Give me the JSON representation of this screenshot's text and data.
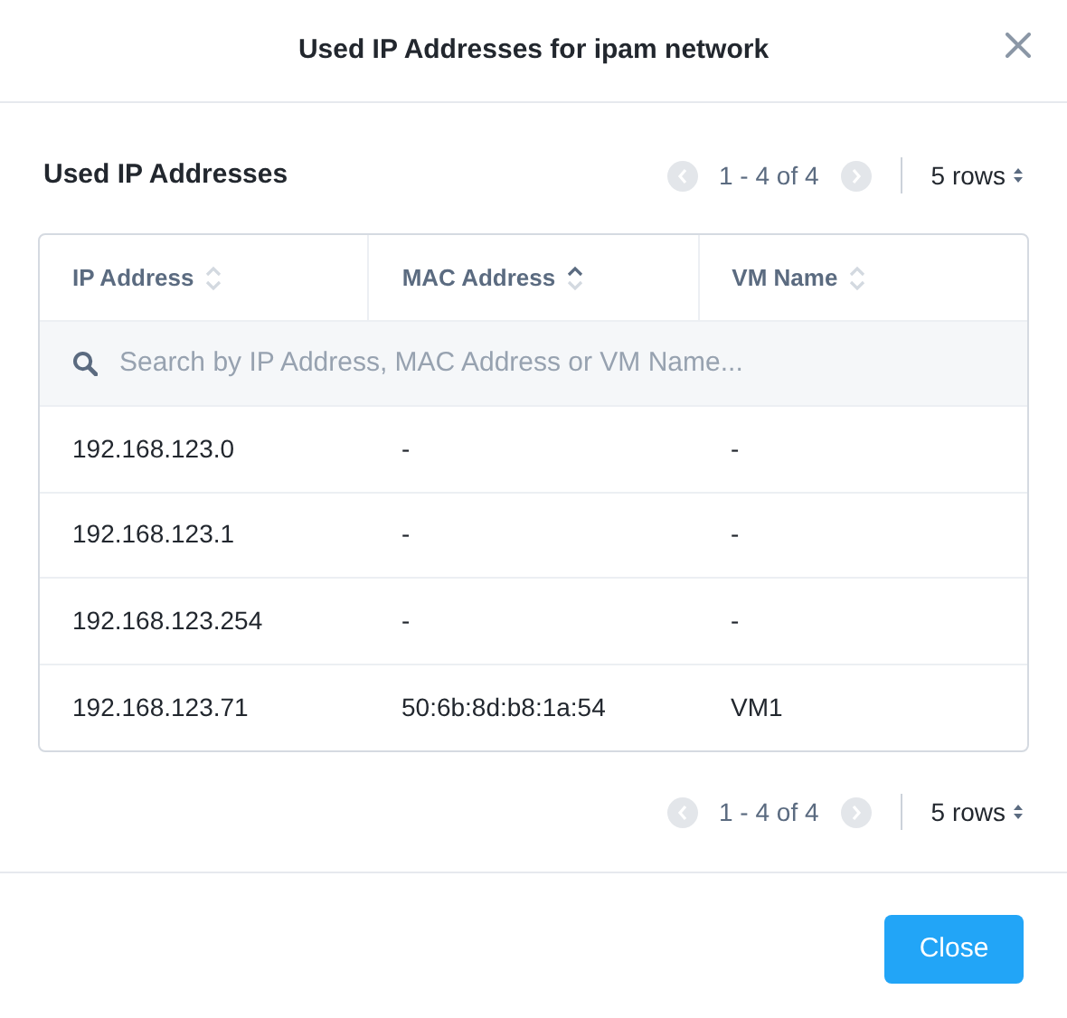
{
  "dialog": {
    "title": "Used IP Addresses for ipam network"
  },
  "section": {
    "title": "Used IP Addresses"
  },
  "pagers": [
    {
      "range": "1 - 4 of 4",
      "prev_disabled": true,
      "next_disabled": true,
      "rows": "5 rows"
    },
    {
      "range": "1 - 4 of 4",
      "prev_disabled": true,
      "next_disabled": true,
      "rows": "5 rows"
    }
  ],
  "table": {
    "columns": [
      {
        "label": "IP Address",
        "sorted": false
      },
      {
        "label": "MAC Address",
        "sorted": true
      },
      {
        "label": "VM Name",
        "sorted": false
      }
    ],
    "search": {
      "placeholder": "Search by IP Address, MAC Address or VM Name..."
    },
    "rows": [
      [
        "192.168.123.0",
        "-",
        "-"
      ],
      [
        "192.168.123.1",
        "-",
        "-"
      ],
      [
        "192.168.123.254",
        "-",
        "-"
      ],
      [
        "192.168.123.71",
        "50:6b:8d:b8:1a:54",
        "VM1"
      ]
    ]
  },
  "buttons": [
    {
      "label": "Close",
      "kind": "primary"
    }
  ]
}
